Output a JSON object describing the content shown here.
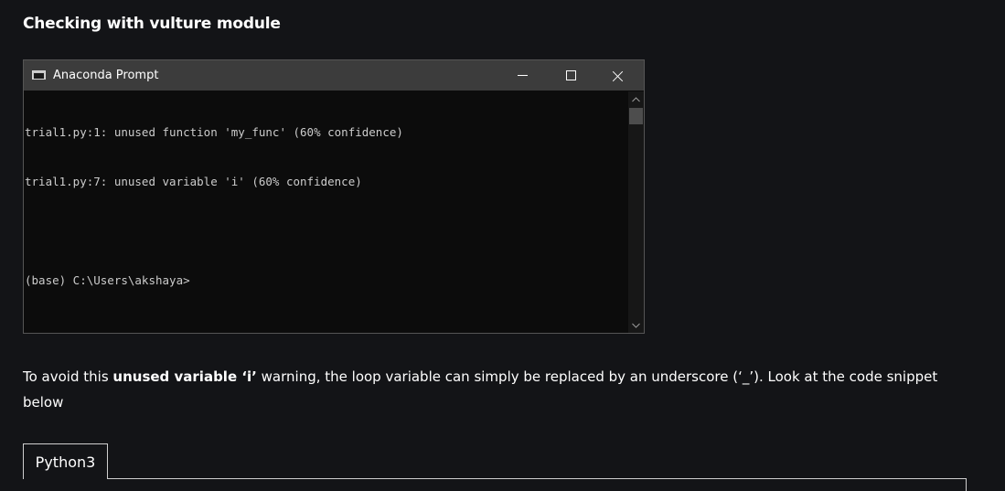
{
  "article": {
    "heading": "Checking with vulture module",
    "paragraph": {
      "before": "To avoid this ",
      "bold": "unused variable ‘i’",
      "after": " warning, the loop variable can simply be replaced by an underscore (‘_’). Look at the code snippet below"
    },
    "code_tab_label": "Python3"
  },
  "terminal": {
    "window_title": "Anaconda Prompt",
    "icons": {
      "app": "console-window-icon",
      "minimize": "minimize-icon",
      "maximize": "maximize-icon",
      "close": "close-icon",
      "scroll_up": "chevron-up-icon",
      "scroll_down": "chevron-down-icon"
    },
    "lines": [
      "trial1.py:1: unused function 'my_func' (60% confidence)",
      "trial1.py:7: unused variable 'i' (60% confidence)",
      "",
      "(base) C:\\Users\\akshaya>"
    ]
  },
  "colors": {
    "page_background": "#131417",
    "terminal_background": "#0c0c0c",
    "titlebar_background": "#3c3c3c",
    "terminal_text": "#cccccc",
    "text": "#ffffff"
  }
}
